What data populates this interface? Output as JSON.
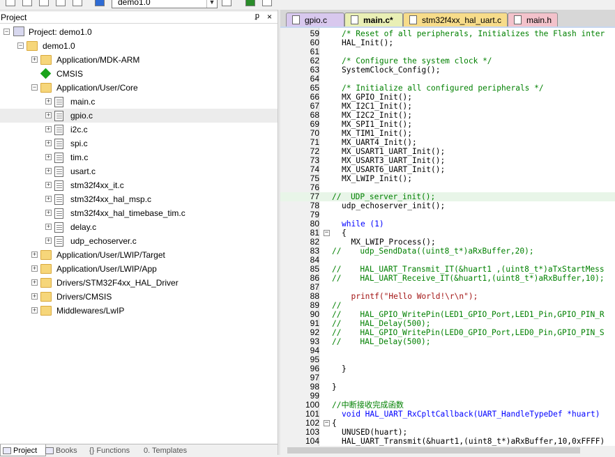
{
  "toolbar": {
    "config_target": "demo1.0"
  },
  "project_panel": {
    "title": "Project",
    "pin_glyph": "ᵱ",
    "close_glyph": "×",
    "root": "Project: demo1.0",
    "target": "demo1.0",
    "items": [
      {
        "label": "Application/MDK-ARM",
        "kind": "folder",
        "level": 2,
        "expand": "+"
      },
      {
        "label": "CMSIS",
        "kind": "cmsis",
        "level": 2,
        "expand": ""
      },
      {
        "label": "Application/User/Core",
        "kind": "folder",
        "level": 2,
        "expand": "−"
      },
      {
        "label": "main.c",
        "kind": "file",
        "level": 3,
        "expand": "+"
      },
      {
        "label": "gpio.c",
        "kind": "file",
        "level": 3,
        "expand": "+",
        "selected": true
      },
      {
        "label": "i2c.c",
        "kind": "file",
        "level": 3,
        "expand": "+"
      },
      {
        "label": "spi.c",
        "kind": "file",
        "level": 3,
        "expand": "+"
      },
      {
        "label": "tim.c",
        "kind": "file",
        "level": 3,
        "expand": "+"
      },
      {
        "label": "usart.c",
        "kind": "file",
        "level": 3,
        "expand": "+"
      },
      {
        "label": "stm32f4xx_it.c",
        "kind": "file",
        "level": 3,
        "expand": "+"
      },
      {
        "label": "stm32f4xx_hal_msp.c",
        "kind": "file",
        "level": 3,
        "expand": "+"
      },
      {
        "label": "stm32f4xx_hal_timebase_tim.c",
        "kind": "file",
        "level": 3,
        "expand": "+"
      },
      {
        "label": "delay.c",
        "kind": "file",
        "level": 3,
        "expand": "+"
      },
      {
        "label": "udp_echoserver.c",
        "kind": "file",
        "level": 3,
        "expand": "+"
      },
      {
        "label": "Application/User/LWIP/Target",
        "kind": "folder",
        "level": 2,
        "expand": "+"
      },
      {
        "label": "Application/User/LWIP/App",
        "kind": "folder",
        "level": 2,
        "expand": "+"
      },
      {
        "label": "Drivers/STM32F4xx_HAL_Driver",
        "kind": "folder",
        "level": 2,
        "expand": "+"
      },
      {
        "label": "Drivers/CMSIS",
        "kind": "folder",
        "level": 2,
        "expand": "+"
      },
      {
        "label": "Middlewares/LwIP",
        "kind": "folder",
        "level": 2,
        "expand": "+"
      }
    ],
    "bottom_tabs": [
      "Project",
      "Books",
      "{} Functions",
      "0. Templates"
    ]
  },
  "editor": {
    "tabs": [
      {
        "label": "gpio.c",
        "color": "#d8c8ee",
        "active": false
      },
      {
        "label": "main.c*",
        "color": "#e9efb5",
        "active": true
      },
      {
        "label": "stm32f4xx_hal_uart.c",
        "color": "#f7dc8a",
        "active": false
      },
      {
        "label": "main.h",
        "color": "#f3c2cb",
        "active": false
      }
    ],
    "lines": [
      {
        "n": "59",
        "t": "/* Reset of all peripherals, Initializes the Flash inter",
        "c": "comment"
      },
      {
        "n": "60",
        "t": "HAL_Init();",
        "c": ""
      },
      {
        "n": "61",
        "t": "",
        "c": ""
      },
      {
        "n": "62",
        "t": "/* Configure the system clock */",
        "c": "comment"
      },
      {
        "n": "63",
        "t": "SystemClock_Config();",
        "c": ""
      },
      {
        "n": "64",
        "t": "",
        "c": ""
      },
      {
        "n": "65",
        "t": "/* Initialize all configured peripherals */",
        "c": "comment"
      },
      {
        "n": "66",
        "t": "MX_GPIO_Init();",
        "c": ""
      },
      {
        "n": "67",
        "t": "MX_I2C1_Init();",
        "c": ""
      },
      {
        "n": "68",
        "t": "MX_I2C2_Init();",
        "c": ""
      },
      {
        "n": "69",
        "t": "MX_SPI1_Init();",
        "c": ""
      },
      {
        "n": "70",
        "t": "MX_TIM1_Init();",
        "c": ""
      },
      {
        "n": "71",
        "t": "MX_UART4_Init();",
        "c": ""
      },
      {
        "n": "72",
        "t": "MX_USART1_UART_Init();",
        "c": ""
      },
      {
        "n": "73",
        "t": "MX_USART3_UART_Init();",
        "c": ""
      },
      {
        "n": "74",
        "t": "MX_USART6_UART_Init();",
        "c": ""
      },
      {
        "n": "75",
        "t": "MX_LWIP_Init();",
        "c": ""
      },
      {
        "n": "76",
        "t": "",
        "c": ""
      },
      {
        "n": "77",
        "t": "//  UDP_server_init();",
        "c": "comment",
        "current": true
      },
      {
        "n": "78",
        "t": "udp_echoserver_init();",
        "c": ""
      },
      {
        "n": "79",
        "t": "",
        "c": ""
      },
      {
        "n": "80",
        "t": "while (1)",
        "c": "kw"
      },
      {
        "n": "81",
        "t": "{",
        "c": "",
        "fold": true
      },
      {
        "n": "82",
        "t": "  MX_LWIP_Process();",
        "c": ""
      },
      {
        "n": "83",
        "t": "//    udp_SendData((uint8_t*)aRxBuffer,20);",
        "c": "comment"
      },
      {
        "n": "84",
        "t": "",
        "c": ""
      },
      {
        "n": "85",
        "t": "//    HAL_UART_Transmit_IT(&huart1 ,(uint8_t*)aTxStartMess",
        "c": "comment"
      },
      {
        "n": "86",
        "t": "//    HAL_UART_Receive_IT(&huart1,(uint8_t*)aRxBuffer,10);",
        "c": "comment"
      },
      {
        "n": "87",
        "t": "",
        "c": ""
      },
      {
        "n": "88",
        "t": "  printf(\"Hello World!\\r\\n\");",
        "c": "str"
      },
      {
        "n": "89",
        "t": "//",
        "c": "comment"
      },
      {
        "n": "90",
        "t": "//    HAL_GPIO_WritePin(LED1_GPIO_Port,LED1_Pin,GPIO_PIN_R",
        "c": "comment"
      },
      {
        "n": "91",
        "t": "//    HAL_Delay(500);",
        "c": "comment"
      },
      {
        "n": "92",
        "t": "//    HAL_GPIO_WritePin(LED0_GPIO_Port,LED0_Pin,GPIO_PIN_S",
        "c": "comment"
      },
      {
        "n": "93",
        "t": "//    HAL_Delay(500);",
        "c": "comment"
      },
      {
        "n": "94",
        "t": "",
        "c": ""
      },
      {
        "n": "95",
        "t": "",
        "c": ""
      },
      {
        "n": "96",
        "t": "}",
        "c": ""
      },
      {
        "n": "97",
        "t": "",
        "c": ""
      },
      {
        "n": "98",
        "t": "}",
        "c": ""
      },
      {
        "n": "99",
        "t": "",
        "c": ""
      },
      {
        "n": "100",
        "t": "//中断接收完成函数",
        "c": "comment"
      },
      {
        "n": "101",
        "t": "void HAL_UART_RxCpltCallback(UART_HandleTypeDef *huart)",
        "c": "kw"
      },
      {
        "n": "102",
        "t": "{",
        "c": "",
        "fold": true
      },
      {
        "n": "103",
        "t": "UNUSED(huart);",
        "c": ""
      },
      {
        "n": "104",
        "t": "HAL_UART_Transmit(&huart1,(uint8_t*)aRxBuffer,10,0xFFFF)",
        "c": ""
      }
    ]
  }
}
